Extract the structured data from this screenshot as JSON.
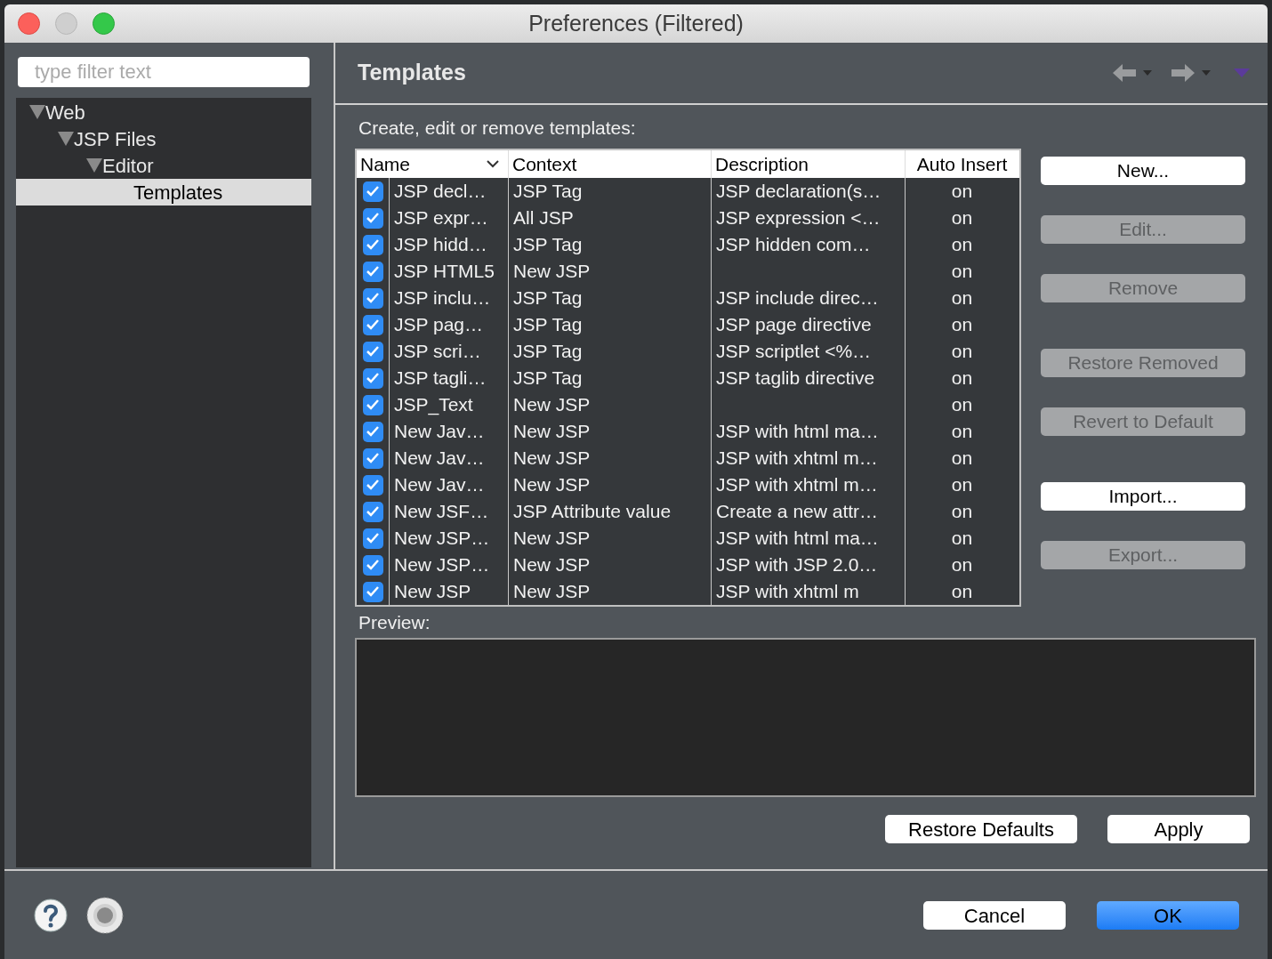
{
  "window": {
    "title": "Preferences (Filtered)"
  },
  "filter": {
    "placeholder": "type filter text"
  },
  "tree": [
    {
      "label": "Web",
      "expanded": true,
      "selected": false,
      "children": [
        {
          "label": "JSP Files",
          "expanded": true,
          "selected": false,
          "children": [
            {
              "label": "Editor",
              "expanded": true,
              "selected": false,
              "children": [
                {
                  "label": "Templates",
                  "selected": true
                }
              ]
            }
          ]
        }
      ]
    }
  ],
  "page": {
    "title": "Templates",
    "description": "Create, edit or remove templates:"
  },
  "table": {
    "columns": [
      {
        "label": "Name",
        "sorted": true
      },
      {
        "label": "Context",
        "sorted": false
      },
      {
        "label": "Description",
        "sorted": false
      },
      {
        "label": "Auto Insert",
        "sorted": false
      }
    ],
    "rows": [
      {
        "checked": true,
        "name": "JSP decl…",
        "context": "JSP Tag",
        "description": "JSP declaration(s…",
        "auto_insert": "on"
      },
      {
        "checked": true,
        "name": "JSP expr…",
        "context": "All JSP",
        "description": "JSP expression <…",
        "auto_insert": "on"
      },
      {
        "checked": true,
        "name": "JSP hidd…",
        "context": "JSP Tag",
        "description": "JSP hidden com…",
        "auto_insert": "on"
      },
      {
        "checked": true,
        "name": "JSP HTML5",
        "context": "New JSP",
        "auto_insert": "on"
      },
      {
        "checked": true,
        "name": "JSP inclu…",
        "context": "JSP Tag",
        "description": "JSP include direc…",
        "auto_insert": "on"
      },
      {
        "checked": true,
        "name": "JSP pag…",
        "context": "JSP Tag",
        "description": "JSP page directive",
        "auto_insert": "on"
      },
      {
        "checked": true,
        "name": "JSP scri…",
        "context": "JSP Tag",
        "description": "JSP scriptlet <%…",
        "auto_insert": "on"
      },
      {
        "checked": true,
        "name": "JSP tagli…",
        "context": "JSP Tag",
        "description": "JSP taglib directive",
        "auto_insert": "on"
      },
      {
        "checked": true,
        "name": "JSP_Text",
        "context": "New JSP",
        "auto_insert": "on"
      },
      {
        "checked": true,
        "name": "New Jav…",
        "context": "New JSP",
        "description": "JSP with html ma…",
        "auto_insert": "on"
      },
      {
        "checked": true,
        "name": "New Jav…",
        "context": "New JSP",
        "description": "JSP with xhtml m…",
        "auto_insert": "on"
      },
      {
        "checked": true,
        "name": "New Jav…",
        "context": "New JSP",
        "description": "JSP with xhtml m…",
        "auto_insert": "on"
      },
      {
        "checked": true,
        "name": "New JSF…",
        "context": "JSP Attribute value",
        "description": "Create a new attr…",
        "auto_insert": "on"
      },
      {
        "checked": true,
        "name": "New JSP…",
        "context": "New JSP",
        "description": "JSP with html ma…",
        "auto_insert": "on"
      },
      {
        "checked": true,
        "name": "New JSP…",
        "context": "New JSP",
        "description": "JSP with JSP 2.0…",
        "auto_insert": "on"
      },
      {
        "checked": true,
        "name": "New JSP",
        "context": "New JSP",
        "description": "JSP with xhtml m",
        "auto_insert": "on"
      }
    ]
  },
  "side_buttons": [
    {
      "label": "New...",
      "disabled": false
    },
    {
      "label": "Edit...",
      "disabled": true
    },
    {
      "label": "Remove",
      "disabled": true
    },
    {
      "label": "Restore Removed",
      "disabled": true
    },
    {
      "label": "Revert to Default",
      "disabled": true
    },
    {
      "label": "Import...",
      "disabled": false
    },
    {
      "label": "Export...",
      "disabled": true
    }
  ],
  "preview": {
    "label": "Preview:"
  },
  "page_buttons": [
    {
      "label": "Restore Defaults"
    },
    {
      "label": "Apply"
    }
  ],
  "dialog_buttons": [
    {
      "label": "Cancel",
      "default": false
    },
    {
      "label": "OK",
      "default": true
    }
  ]
}
